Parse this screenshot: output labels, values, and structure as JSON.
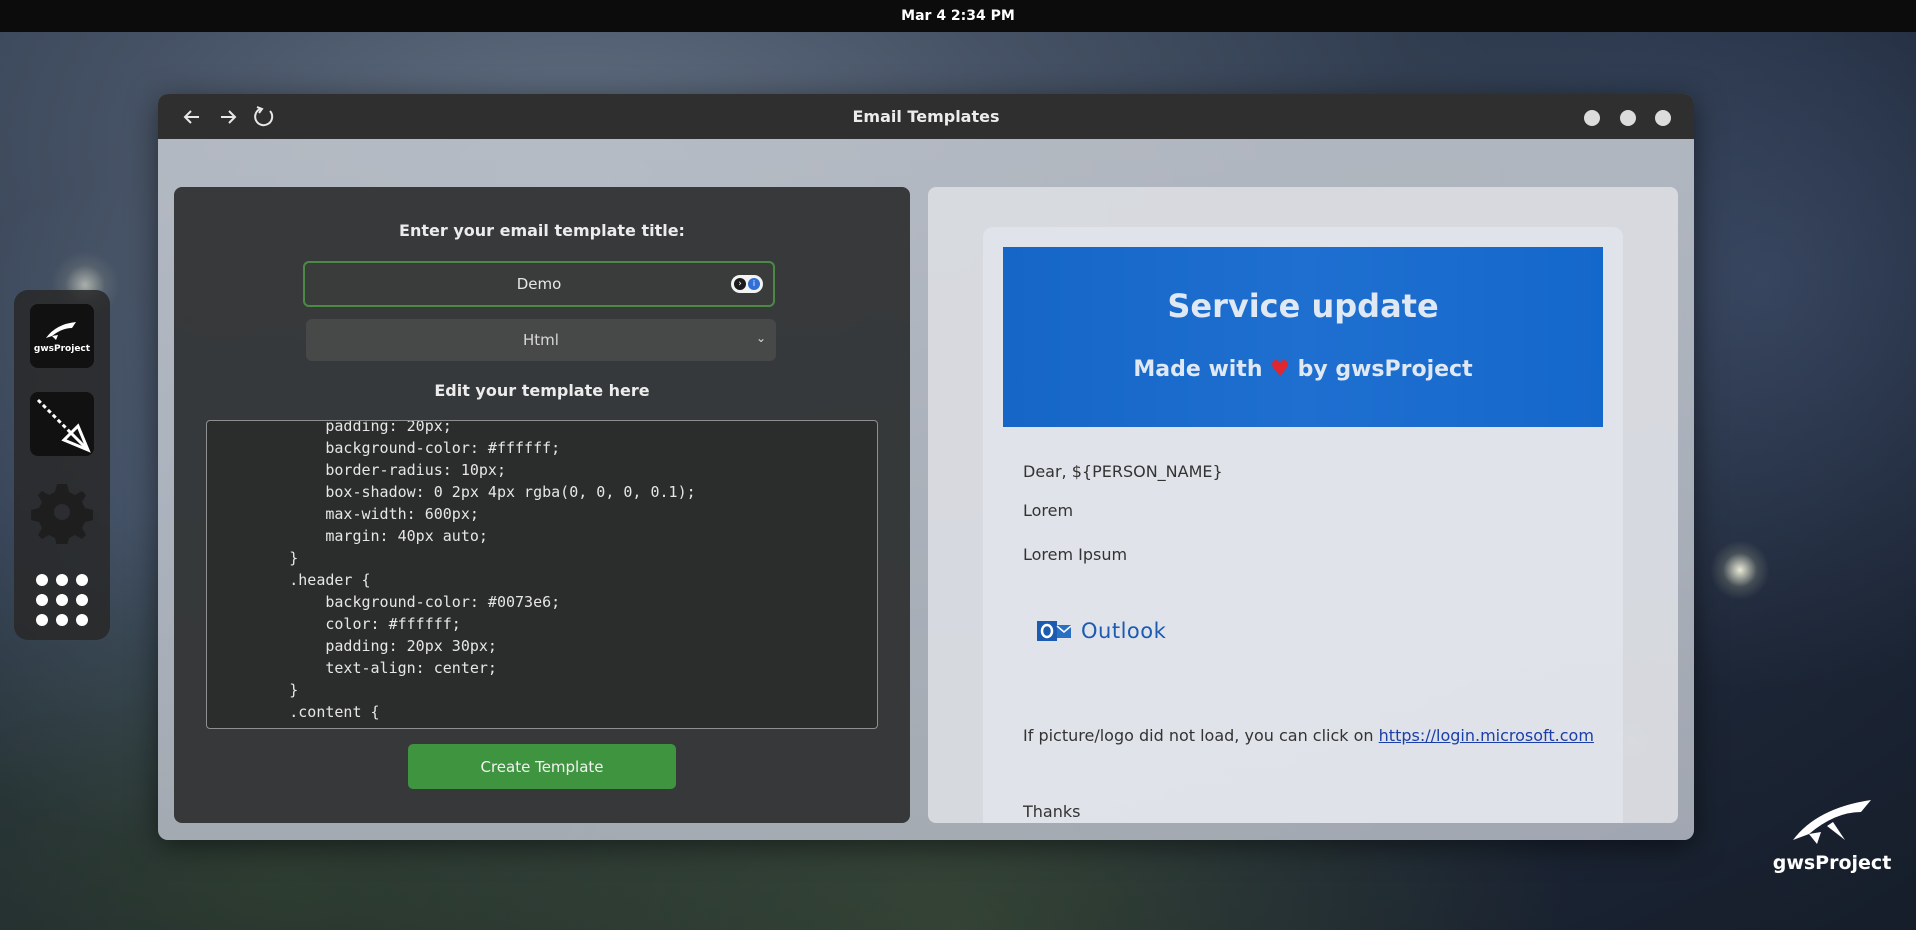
{
  "topbar": {
    "clock": "Mar 4  2:34 PM"
  },
  "dock": {
    "items": [
      {
        "name": "gwsproject-app",
        "label": "gwsProject"
      },
      {
        "name": "arrow-app"
      },
      {
        "name": "settings-app"
      },
      {
        "name": "app-grid"
      }
    ]
  },
  "window": {
    "title": "Email Templates"
  },
  "editor_panel": {
    "title_prompt": "Enter your email template title:",
    "title_value": "Demo",
    "type_selected": "Html",
    "edit_heading": "Edit your template here",
    "code_lines": [
      "            padding: 20px;",
      "            background-color: #ffffff;",
      "            border-radius: 10px;",
      "            box-shadow: 0 2px 4px rgba(0, 0, 0, 0.1);",
      "            max-width: 600px;",
      "            margin: 40px auto;",
      "        }",
      "        .header {",
      "            background-color: #0073e6;",
      "            color: #ffffff;",
      "            padding: 20px 30px;",
      "            text-align: center;",
      "        }",
      "        .content {"
    ],
    "create_button": "Create Template"
  },
  "preview": {
    "header_title": "Service update",
    "header_sub_before": "Made with",
    "header_sub_heart": "♥",
    "header_sub_after": "by gwsProject",
    "greeting": "Dear, ${PERSON_NAME}",
    "line1": "Lorem",
    "line2": "Lorem Ipsum",
    "logo_text": "Outlook",
    "fallback_text": "If picture/logo did not load, you can click on",
    "fallback_link": "https://login.microsoft.com",
    "closing": "Thanks"
  },
  "brand": {
    "label": "gwsProject"
  },
  "colors": {
    "accent_green": "#3f9440",
    "header_blue": "#1566c7",
    "heart_red": "#e0262f"
  }
}
